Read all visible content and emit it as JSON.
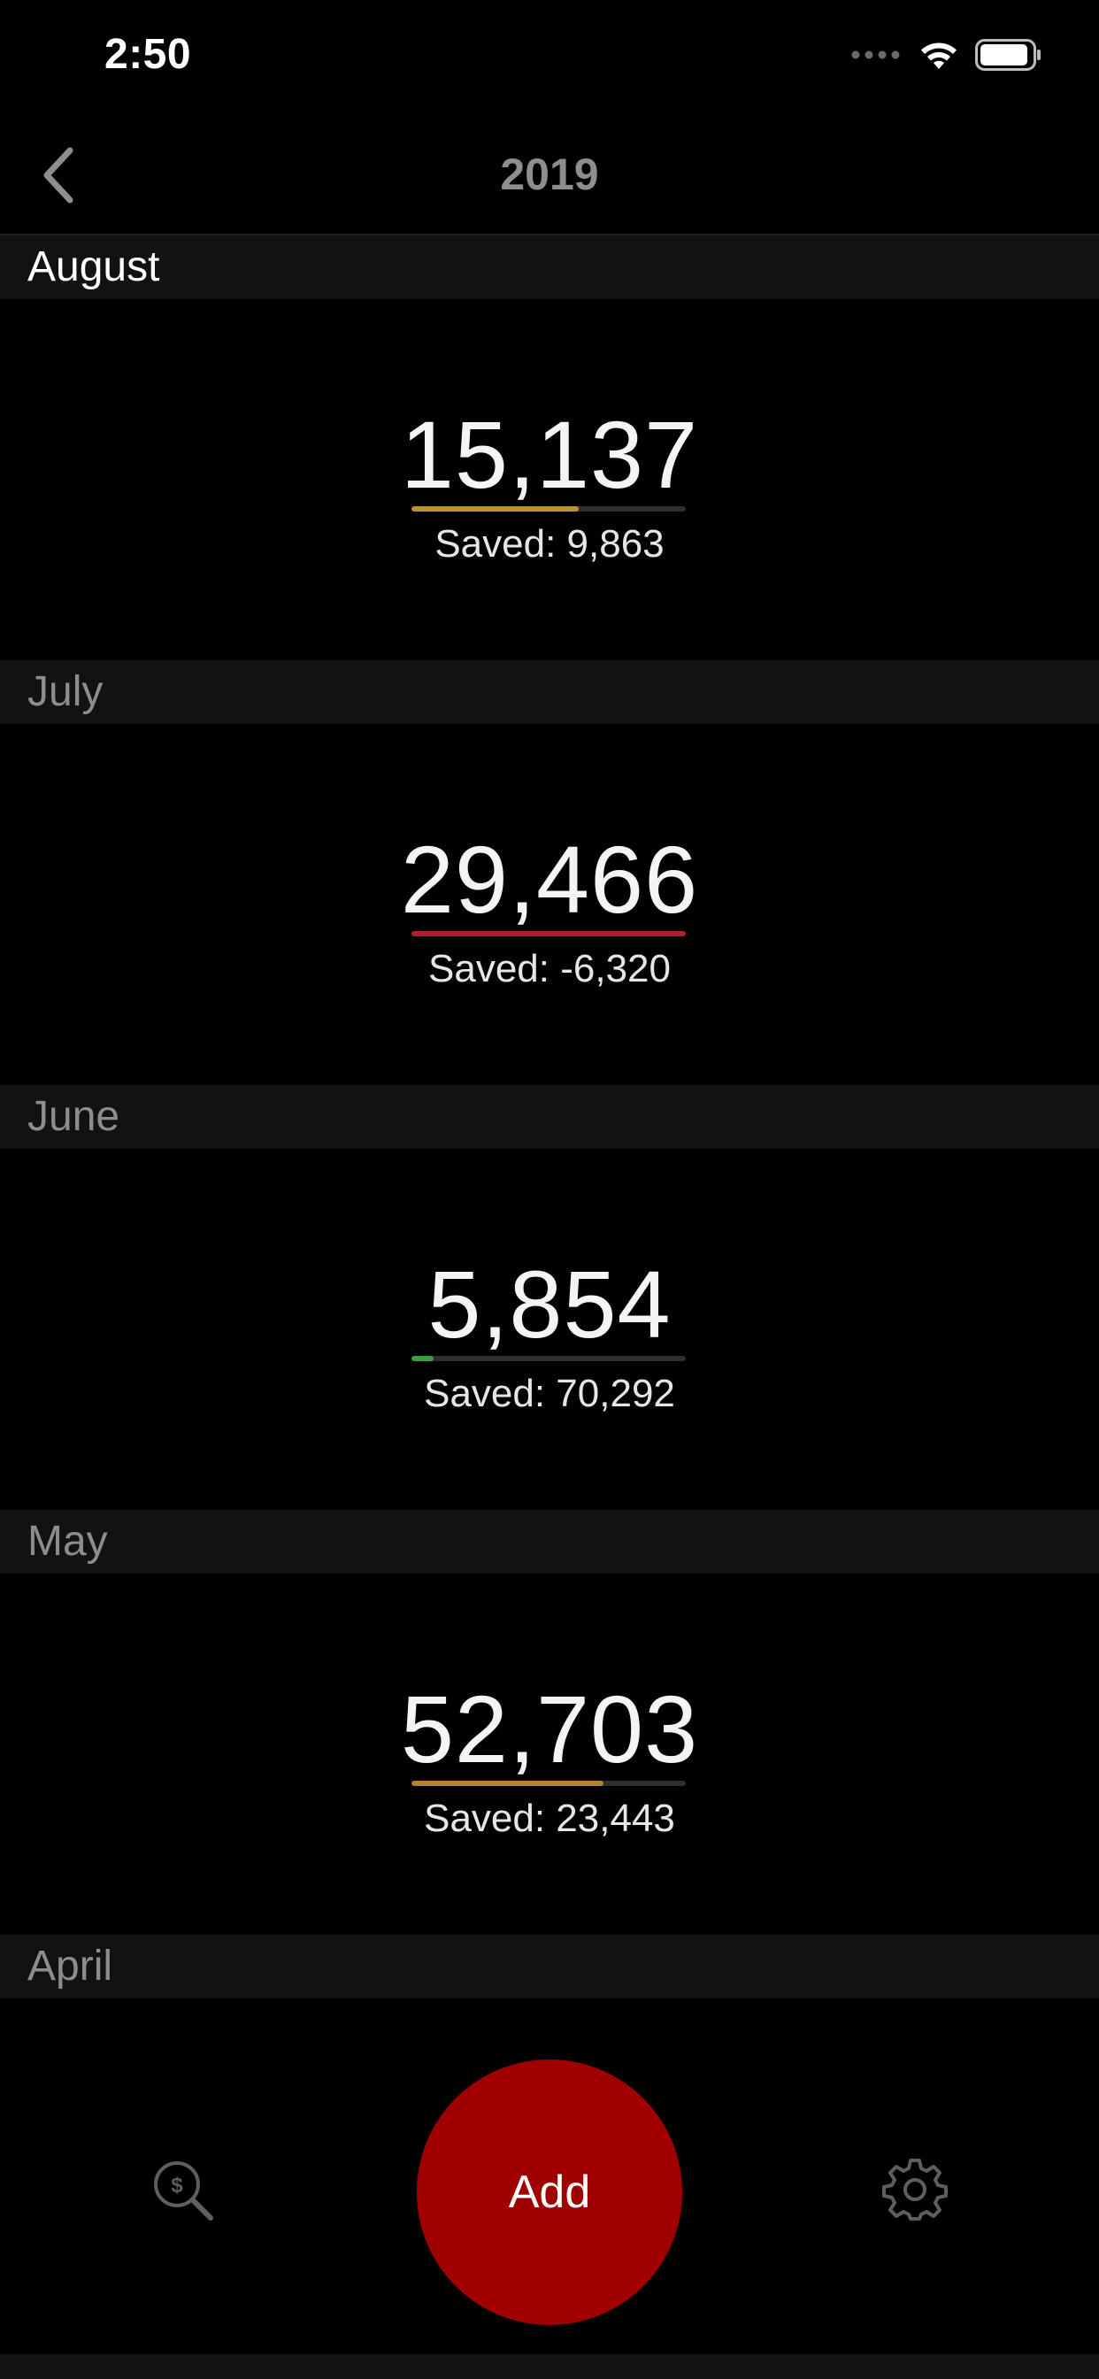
{
  "status_bar": {
    "time": "2:50"
  },
  "nav": {
    "title": "2019",
    "back_icon": "chevron-left-icon"
  },
  "months": [
    {
      "name": "August",
      "spent": "15,137",
      "saved_label": "Saved: 9,863",
      "progress": 0.61,
      "bar_color": "#b8922a",
      "current": true
    },
    {
      "name": "July",
      "spent": "29,466",
      "saved_label": "Saved: -6,320",
      "progress": 1.0,
      "bar_color": "#b0202a",
      "current": false
    },
    {
      "name": "June",
      "spent": "5,854",
      "saved_label": "Saved: 70,292",
      "progress": 0.08,
      "bar_color": "#3aa03a",
      "current": false
    },
    {
      "name": "May",
      "spent": "52,703",
      "saved_label": "Saved: 23,443",
      "progress": 0.7,
      "bar_color": "#b8802a",
      "current": false
    },
    {
      "name": "April",
      "spent": "",
      "saved_label": "",
      "progress": 0.0,
      "bar_color": "#b8922a",
      "current": false
    }
  ],
  "bottom_bar": {
    "add_label": "Add",
    "search_icon": "dollar-search-icon",
    "settings_icon": "gear-icon"
  },
  "colors": {
    "accent_red": "#a00000",
    "section_header_bg": "#121212"
  }
}
